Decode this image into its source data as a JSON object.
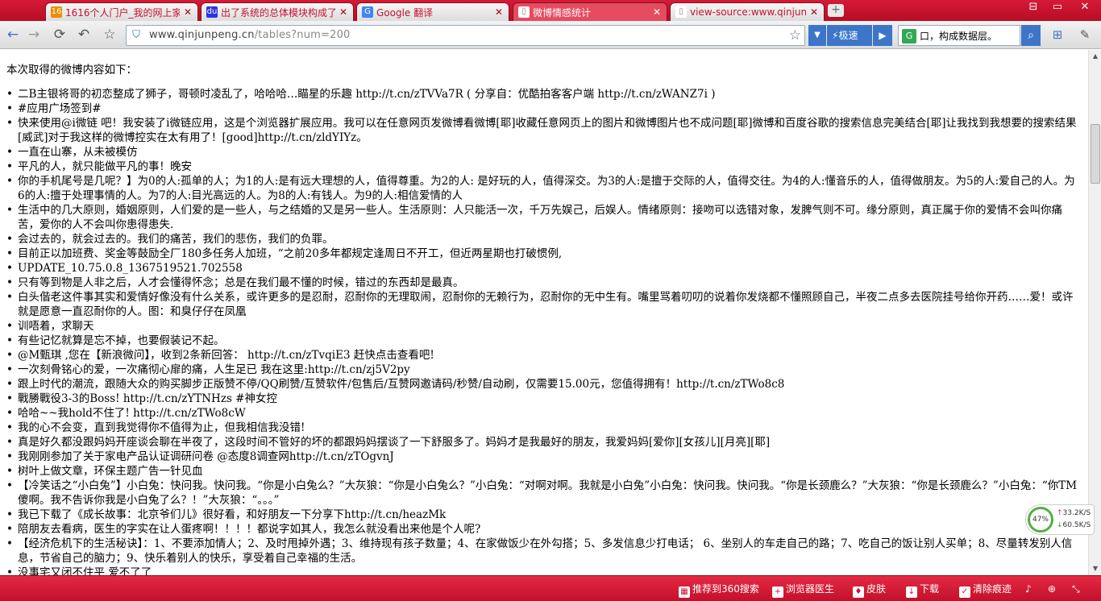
{
  "browser": {
    "tabs": [
      {
        "title": "1616个人门户_我的网上家",
        "favicon": "16"
      },
      {
        "title": "出了系统的总体模块构成了",
        "favicon": "du"
      },
      {
        "title": "Google 翻译",
        "favicon": "G"
      },
      {
        "title": "微博情感统计",
        "favicon": "page"
      },
      {
        "title": "view-source:www.qinjunp",
        "favicon": "page"
      }
    ],
    "active_tab": 3,
    "newtab_label": "+",
    "window_controls": [
      "⊟",
      "▭",
      "✕"
    ],
    "address": {
      "domain": "www.qinjunpeng.cn",
      "path": "/tables?num=200"
    },
    "speed_label": "极速",
    "search_value": "口，构成数据层。",
    "colors": {
      "brand": "#c8102e",
      "accent": "#3d76c9"
    }
  },
  "page": {
    "intro": "本次取得的微博内容如下：",
    "items": [
      "二B主银将哥的初恋整成了狮子，哥顿时凌乱了，哈哈哈…瞄星的乐趣 http://t.cn/zTVVa7R ( 分享自：优酷拍客客户端 http://t.cn/zWANZ7i )",
      "#应用广场签到#",
      "快来使用@i微链 吧！我安装了i微链应用，这是个浏览器扩展应用。我可以在任意网页发微博看微博[耶]收藏任意网页上的图片和微博图片也不成问题[耶]微博和百度谷歌的搜索信息完美结合[耶]让我找到我想要的搜索结果[威武]对于我这样的微博控实在太有用了！[good]http://t.cn/zldYIYz。",
      "一直在山寨，从未被模仿",
      "平凡的人，就只能做平凡的事！晚安",
      "你的手机尾号是几呢？】为0的人:孤单的人；为1的人:是有远大理想的人，值得尊重。为2的人: 是好玩的人，值得深交。为3的人:是擅于交际的人，值得交往。为4的人:懂音乐的人，值得做朋友。为5的人:爱自己的人。为6的人:擅于处理事情的人。为7的人:目光高远的人。为8的人:有钱人。为9的人:相信爱情的人",
      "生活中的几大原则，婚姻原则，人们爱的是一些人，与之结婚的又是另一些人。生活原则：人只能活一次，千万先娱己，后娱人。情绪原则：接吻可以选错对象，发脾气则不可。缘分原则，真正属于你的爱情不会叫你痛苦，爱你的人不会叫你患得患失.",
      "会过去的，就会过去的。我们的痛苦，我们的悲伤，我们的负罪。",
      "目前正以加班费、奖金等鼓励全厂180多任务人加班，“之前20多年都规定逢周日不开工，但近两星期也打破惯例,",
      "UPDATE_10.75.0.8_1367519521.702558",
      "只有等到物是人非之后，人才会懂得怀念；总是在我们最不懂的时候，错过的东西却是最真。",
      "白头偕老这件事其实和爱情好像没有什么关系，或许更多的是忍耐，忍耐你的无理取闹，忍耐你的无赖行为，忍耐你的无中生有。嘴里骂着叨叨的说着你发烧都不懂照顾自己，半夜二点多去医院挂号给你开药……爱！或许就是愿意一直忍耐你的人。图：和臭仔仔在凤凰",
      "训唔着，求聊天",
      "有些记忆就算是忘不掉，也要假装记不起。",
      "@M甄琪 ,您在【新浪微问】，收到2条新回答： http://t.cn/zTvqiE3 赶快点击查看吧!",
      "一次刻骨铭心的爱，一次痛彻心扉的痛，人生足已 我在这里:http://t.cn/zj5V2py",
      "跟上时代的潮流，跟随大众的购买脚步正版赞不停/QQ刷赞/互赞软件/包售后/互赞网邀请码/秒赞/自动刷，仅需要15.00元，您值得拥有！http://t.cn/zTWo8c8",
      "戰勝戰役3-3的Boss! http://t.cn/zYTNHzs #神女控",
      "哈哈~~我hold不住了! http://t.cn/zTWo8cW",
      "我的心不会变，直到我觉得你不值得为止，但我相信我没错!",
      "真是好久都没跟妈妈开座谈会聊在半夜了，这段时间不管好的坏的都跟妈妈摆谈了一下舒服多了。妈妈才是我最好的朋友，我爱妈妈[爱你][女孩儿][月亮][耶]",
      "我刚刚参加了关于家电产品认证调研问卷 @态度8调查网http://t.cn/zTOgvnJ",
      "树叶上做文章，环保主题广告一针见血",
      "【冷笑话之“小白兔”】小白兔：快问我。快问我。“你是小白兔么？”大灰狼：“你是小白兔么？”小白兔：“对啊对啊。我就是小白兔”小白兔：快问我。快问我。“你是长颈鹿么？”大灰狼：“你是长颈鹿么？”小白兔：“你TM傻啊。我不告诉你我是小白兔了么？！”大灰狼：“。。。”",
      "我已下载了《成长故事：北京爷们儿》很好看，和好朋友一下分享下http://t.cn/heazMk",
      "陪朋友去看病，医生的字实在让人蛋疼啊！！！！都说字如其人，我怎么就没看出来他是个人呢?",
      "【经济危机下的生活秘诀】：1、不要添加情人；2、及时甩掉外遇；3、维持现有孩子数量；4、在家做饭少在外勾搭；5、多发信息少打电话； 6、坐别人的车走自己的路；7、吃自己的饭让别人买单；8、尽量转发别人信息，节省自己的脑力；9、快乐着别人的快乐，享受着自己幸福的生活。",
      "没事宅又闭不住平 爱不了了"
    ]
  },
  "netmon": {
    "percent": "47%",
    "up": "33.2K/S",
    "down": "60.5K/S"
  },
  "statusbar": {
    "items": [
      {
        "label": "推荐到360搜索",
        "icon": "share-icon"
      },
      {
        "label": "浏览器医生",
        "icon": "doctor-icon"
      },
      {
        "label": "皮肤",
        "icon": "skin-icon"
      },
      {
        "label": "下载",
        "icon": "download-icon"
      },
      {
        "label": "清除痕迹",
        "icon": "clear-icon"
      }
    ]
  }
}
